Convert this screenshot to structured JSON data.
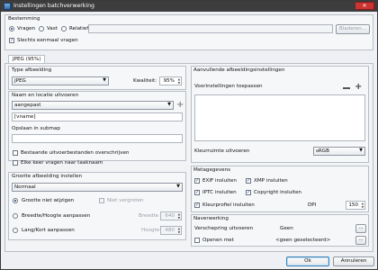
{
  "window": {
    "title": "Instellingen batchverwerking",
    "close": "✕"
  },
  "destination": {
    "label": "Bestemming",
    "options": [
      "Vragen",
      "Vast",
      "Relatief"
    ],
    "selected": 0,
    "path_value": "",
    "browse_label": "Bladeren...",
    "ask_once_label": "Slechts eenmaal vragen"
  },
  "tab": {
    "label": "JPEG (95%)"
  },
  "image_type": {
    "label": "Type afbeelding",
    "format": "JPEG",
    "quality_label": "Kwaliteit:",
    "quality_value": "95%"
  },
  "output_name": {
    "label": "Naam en locatie uitvoeren",
    "mode": "aangepast",
    "pattern": "[vname]",
    "subfolder_label": "Opslaan in submap",
    "subfolder_value": "",
    "overwrite_label": "Bestaande uitvoerbestanden overschrijven",
    "ask_each_label": "Elke keer vragen naar taaknaam"
  },
  "resize": {
    "label": "Grootte afbeelding instellen",
    "mode": "Normaal",
    "options": [
      "Grootte niet wijzigen",
      "Breedte/Hoogte aanpassen",
      "Lang/Kort aanpassen"
    ],
    "selected": 0,
    "no_enlarge_label": "Niet vergroten",
    "width_label": "Breedte",
    "width_value": "640",
    "height_label": "Hoogte",
    "height_value": "480"
  },
  "extra": {
    "label": "Aanvullende afbeeldingsinstellingen",
    "presets_label": "Voorinstellingen toepassen",
    "colorspace_label": "Kleurruimte uitvoeren",
    "colorspace_value": "sRGB"
  },
  "metadata": {
    "label": "Metagegevens",
    "exif": "EXIF insluiten",
    "xmp": "XMP insluiten",
    "iptc": "IPTC insluiten",
    "copyright": "Copyright insluiten",
    "profile": "Kleurprofiel insluiten",
    "dpi_label": "DPI",
    "dpi_value": "150"
  },
  "post": {
    "label": "Naverwerking",
    "send_label": "Verschepring uitvoeren",
    "send_value": "Geen",
    "open_label": "Openen met",
    "open_value": "<geen geselecteerd>",
    "dots": "..."
  },
  "footer": {
    "ok": "Ok",
    "cancel": "Annuleren"
  },
  "colors": {
    "accent": "#1f3c74",
    "titlebar": "#3d3d3d",
    "close": "#cc3333"
  }
}
